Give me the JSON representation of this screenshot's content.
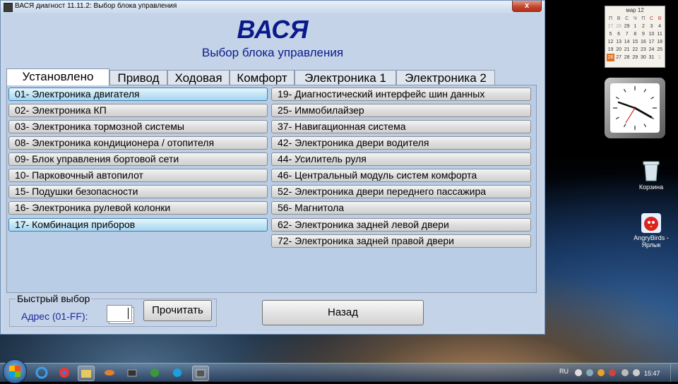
{
  "window": {
    "title": "ВАСЯ диагност 11.11.2:  Выбор блока управления",
    "close_label": "x"
  },
  "header": {
    "title": "ВАСЯ",
    "subtitle": "Выбор блока управления"
  },
  "tabs": [
    {
      "label": "Установлено",
      "active": true
    },
    {
      "label": "Привод",
      "active": false
    },
    {
      "label": "Ходовая",
      "active": false
    },
    {
      "label": "Комфорт",
      "active": false
    },
    {
      "label": "Электроника 1",
      "active": false
    },
    {
      "label": "Электроника 2",
      "active": false
    }
  ],
  "modules_left": [
    {
      "label": "01- Электроника двигателя",
      "highlighted": true
    },
    {
      "label": "02- Электроника КП",
      "highlighted": false
    },
    {
      "label": "03- Электроника тормозной системы",
      "highlighted": false
    },
    {
      "label": "08- Электроника кондиционера / отопителя",
      "highlighted": false
    },
    {
      "label": "09- Блок управления бортовой сети",
      "highlighted": false
    },
    {
      "label": "10- Парковочный автопилот",
      "highlighted": false
    },
    {
      "label": "15- Подушки безопасности",
      "highlighted": false
    },
    {
      "label": "16- Электроника рулевой колонки",
      "highlighted": false
    },
    {
      "label": "17- Комбинация приборов",
      "highlighted": true
    }
  ],
  "modules_right": [
    {
      "label": "19- Диагностический интерфейс шин данных"
    },
    {
      "label": "25- Иммобилайзер"
    },
    {
      "label": "37- Навигационная система"
    },
    {
      "label": "42- Электроника двери водителя"
    },
    {
      "label": "44- Усилитель руля"
    },
    {
      "label": "46- Центральный модуль систем комфорта"
    },
    {
      "label": "52- Электроника двери переднего пассажира"
    },
    {
      "label": "56- Магнитола"
    },
    {
      "label": "62- Электроника задней левой двери"
    },
    {
      "label": "72- Электроника задней правой двери"
    }
  ],
  "quick_select": {
    "legend": "Быстрый выбор",
    "address_label": "Адрес (01-FF):",
    "address_value": "",
    "read_button": "Прочитать"
  },
  "back_button": "Назад",
  "calendar": {
    "month": "мар 12",
    "weekdays": [
      "П",
      "В",
      "С",
      "Ч",
      "П",
      "С",
      "В"
    ],
    "days": [
      "27",
      "28",
      "29",
      "1",
      "2",
      "3",
      "4",
      "5",
      "6",
      "7",
      "8",
      "9",
      "10",
      "11",
      "12",
      "13",
      "14",
      "15",
      "16",
      "17",
      "18",
      "19",
      "20",
      "21",
      "22",
      "23",
      "24",
      "25",
      "26",
      "27",
      "28",
      "29",
      "30",
      "31",
      "1"
    ],
    "today": "26"
  },
  "desktop_icons": [
    {
      "label": "Корзина",
      "icon": "recycle-bin-icon"
    },
    {
      "label": "AngryBirds - Ярлык",
      "icon": "angry-birds-icon"
    }
  ],
  "taskbar": {
    "language": "RU",
    "time": "15:47"
  },
  "colors": {
    "accent": "#0a1a8a",
    "panel": "#b9cde6",
    "highlight": "#a8d6f0"
  }
}
